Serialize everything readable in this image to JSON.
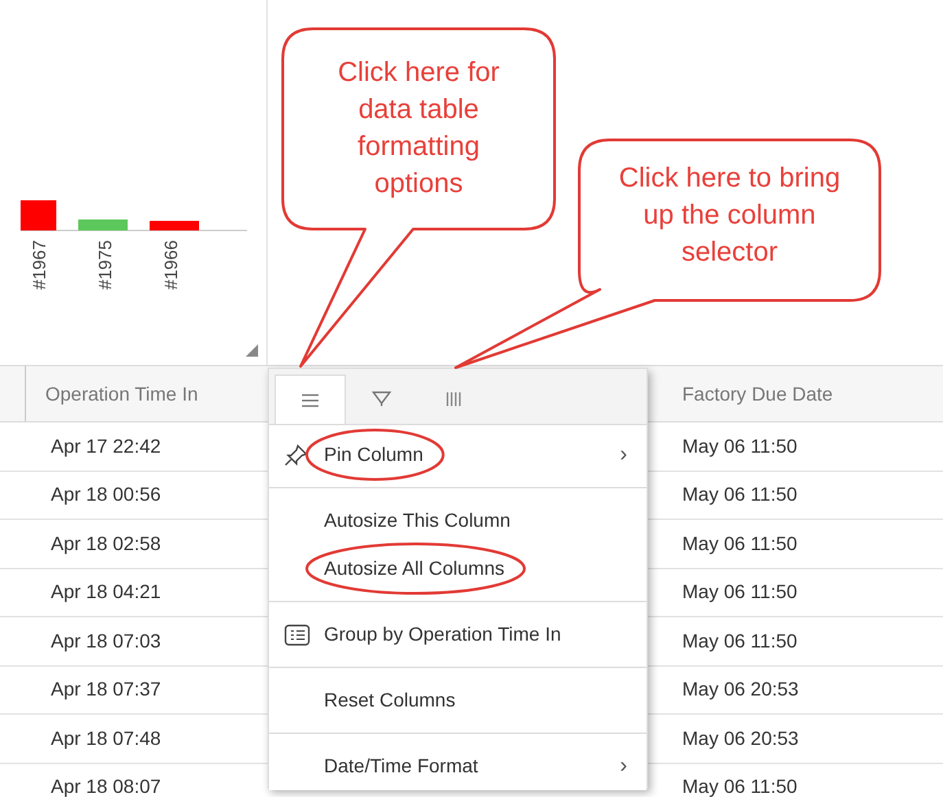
{
  "chart": {
    "bars": [
      {
        "label": "#1967",
        "color": "#ff0000"
      },
      {
        "label": "#1975",
        "color": "#5cc85c"
      },
      {
        "label": "#1966",
        "color": "#ff0000"
      }
    ]
  },
  "table": {
    "columns": [
      "Operation Time In",
      "Factory Due Date"
    ],
    "rows": [
      [
        "Apr 17 22:42",
        "May 06 11:50"
      ],
      [
        "Apr 18 00:56",
        "May 06 11:50"
      ],
      [
        "Apr 18 02:58",
        "May 06 11:50"
      ],
      [
        "Apr 18 04:21",
        "May 06 11:50"
      ],
      [
        "Apr 18 07:03",
        "May 06 11:50"
      ],
      [
        "Apr 18 07:37",
        "May 06 20:53"
      ],
      [
        "Apr 18 07:48",
        "May 06 20:53"
      ],
      [
        "Apr 18 08:07",
        "May 06 11:50"
      ]
    ]
  },
  "column_menu": {
    "tabs": [
      {
        "kind": "menu",
        "selected": true
      },
      {
        "kind": "filter",
        "selected": false
      },
      {
        "kind": "columns",
        "selected": false
      }
    ],
    "sections": [
      [
        {
          "label": "Pin Column",
          "kind": "pin",
          "chevron": "›",
          "highlighted": true
        }
      ],
      [
        {
          "label": "Autosize This Column",
          "kind": "plain",
          "highlighted": false
        },
        {
          "label": "Autosize All Columns",
          "kind": "plain",
          "highlighted": true
        }
      ],
      [
        {
          "label": "Group by Operation Time In",
          "kind": "group",
          "highlighted": false
        }
      ],
      [
        {
          "label": "Reset Columns",
          "kind": "plain",
          "highlighted": false
        }
      ],
      [
        {
          "label": "Date/Time Format",
          "kind": "plain",
          "chevron": "›",
          "highlighted": false
        }
      ]
    ]
  },
  "callouts": [
    {
      "text": "Click here for data table formatting options"
    },
    {
      "text": "Click here to bring up the column selector"
    }
  ]
}
